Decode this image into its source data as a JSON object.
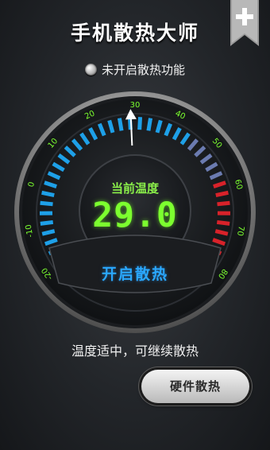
{
  "header": {
    "title": "手机散热大师",
    "add_icon": "plus-icon"
  },
  "status": {
    "text": "未开启散热功能",
    "enabled": false
  },
  "gauge": {
    "label": "当前温度",
    "value": "29.0",
    "temperature": 29.0,
    "ticks": [
      "-20",
      "-10",
      "0",
      "10",
      "20",
      "30",
      "40",
      "50",
      "60",
      "70",
      "80"
    ],
    "scale_min": -20,
    "scale_max": 80,
    "start_button": "开启散热"
  },
  "message": "温度适中，可继续散热",
  "hardware_button": "硬件散热",
  "colors": {
    "accent_green": "#7cff2f",
    "accent_blue": "#2aa8ff",
    "segment_cool": "#1ea0e8",
    "segment_mid": "#6b7bb0",
    "segment_hot": "#d8222a"
  }
}
